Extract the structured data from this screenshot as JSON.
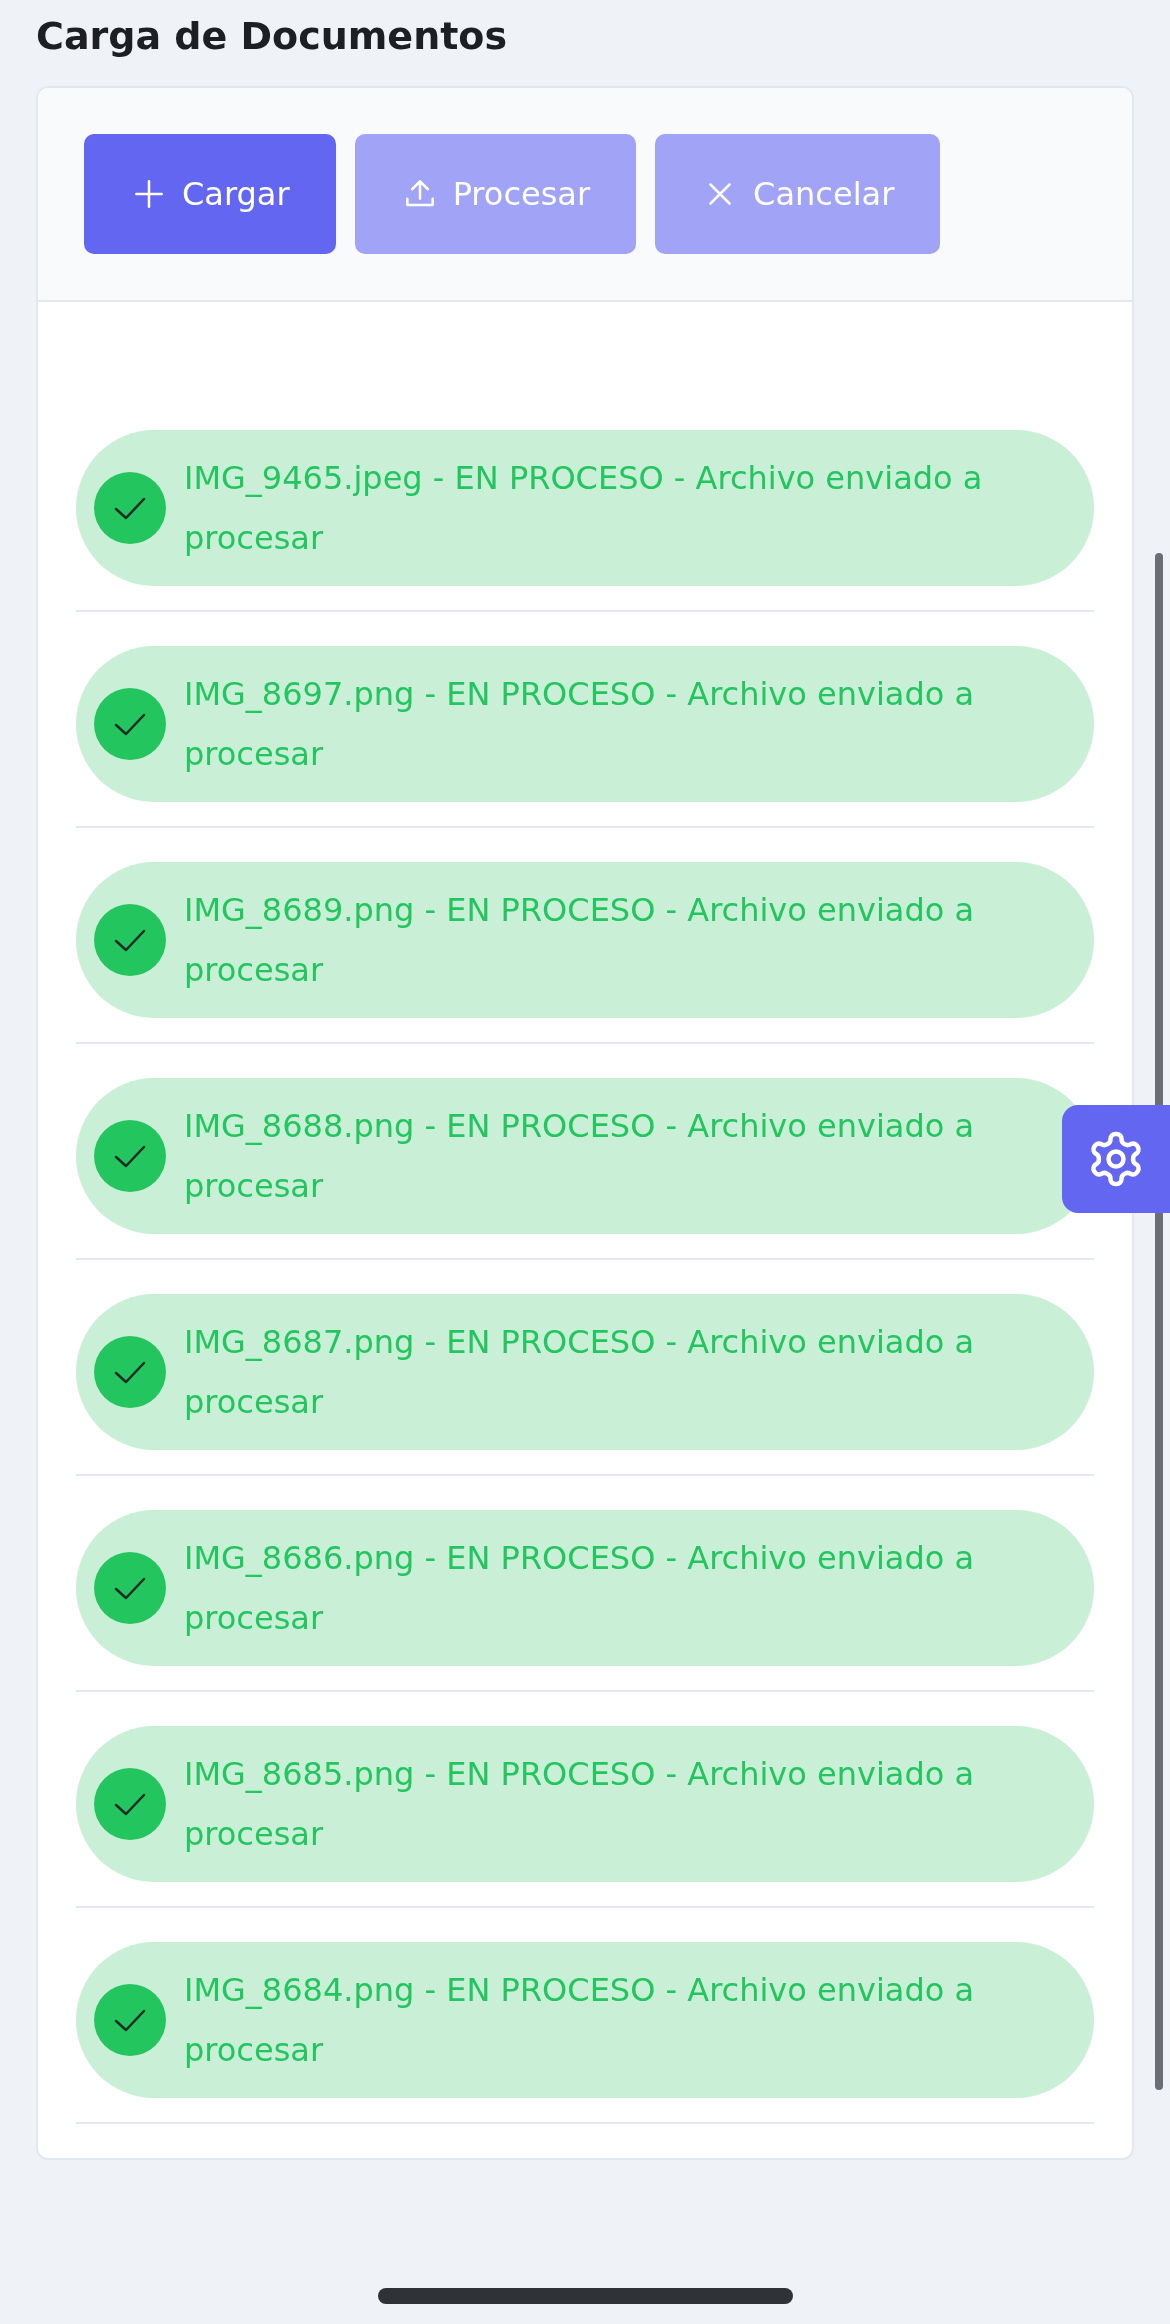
{
  "page_title": "Carga de Documentos",
  "toolbar": [
    {
      "kind": "add",
      "label": "Cargar",
      "disabled": false
    },
    {
      "kind": "upload",
      "label": "Procesar",
      "disabled": true
    },
    {
      "kind": "cancel",
      "label": "Cancelar",
      "disabled": true
    }
  ],
  "messages": [
    {
      "kind": "success",
      "text": "IMG_9465.jpeg - EN PROCESO - Archivo enviado a procesar"
    },
    {
      "kind": "success",
      "text": "IMG_8697.png - EN PROCESO - Archivo enviado a procesar"
    },
    {
      "kind": "success",
      "text": "IMG_8689.png - EN PROCESO - Archivo enviado a procesar"
    },
    {
      "kind": "success",
      "text": "IMG_8688.png - EN PROCESO - Archivo enviado a procesar"
    },
    {
      "kind": "success",
      "text": "IMG_8687.png - EN PROCESO - Archivo enviado a procesar"
    },
    {
      "kind": "success",
      "text": "IMG_8686.png - EN PROCESO - Archivo enviado a procesar"
    },
    {
      "kind": "success",
      "text": "IMG_8685.png - EN PROCESO - Archivo enviado a procesar"
    },
    {
      "kind": "success",
      "text": "IMG_8684.png - EN PROCESO - Archivo enviado a procesar"
    }
  ]
}
